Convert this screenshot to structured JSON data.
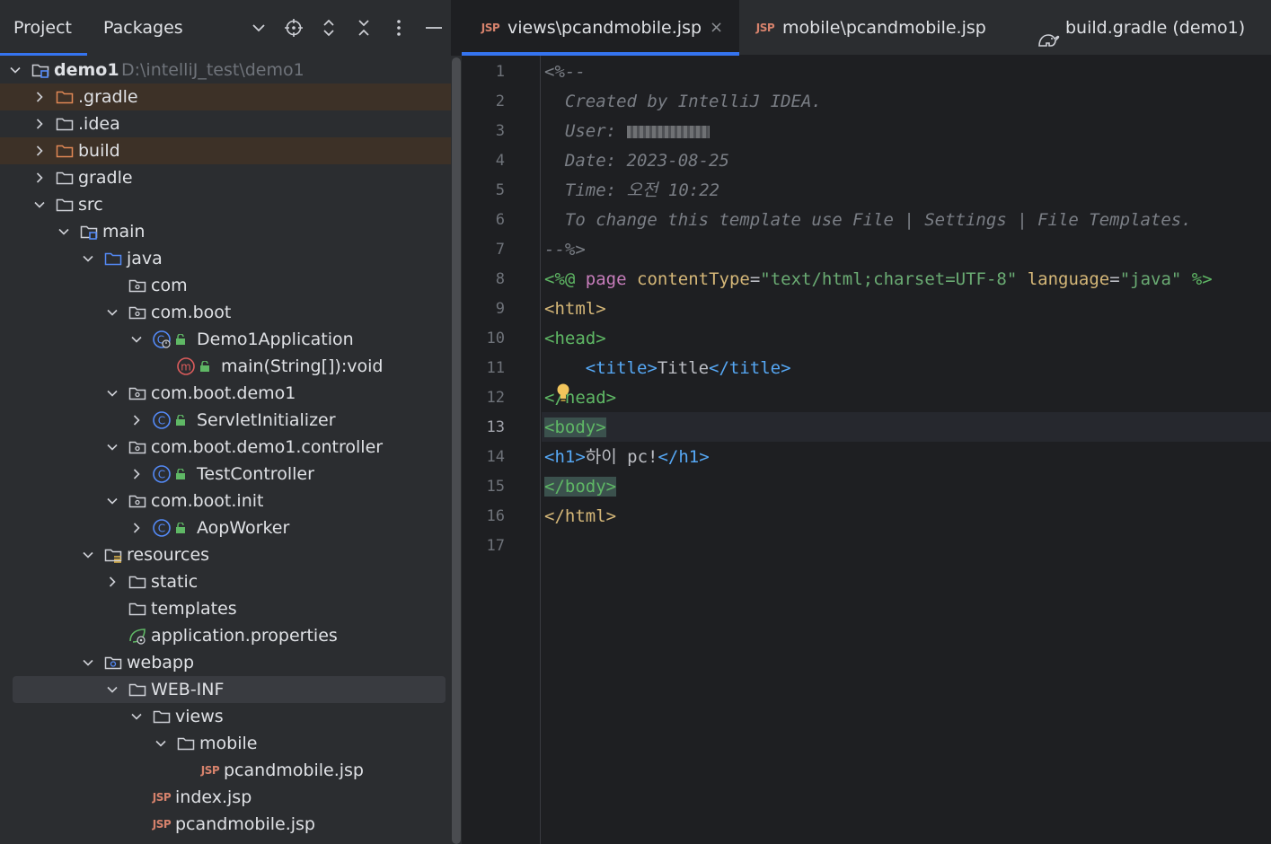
{
  "project_panel": {
    "tabs": [
      "Project",
      "Packages"
    ],
    "header_icons": [
      "chevron-down-icon",
      "locate-icon",
      "expand-all-icon",
      "collapse-all-icon",
      "more-icon",
      "minimize-icon"
    ],
    "tree": [
      {
        "label": "demo1",
        "extra": "D:\\intelliJ_test\\demo1",
        "level": 0,
        "expanded": true,
        "icon": "module-folder-icon",
        "bold": true
      },
      {
        "label": ".gradle",
        "level": 1,
        "expanded": false,
        "icon": "excluded-folder-icon",
        "highlight": true
      },
      {
        "label": ".idea",
        "level": 1,
        "expanded": false,
        "icon": "folder-icon"
      },
      {
        "label": "build",
        "level": 1,
        "expanded": false,
        "icon": "excluded-folder-icon",
        "highlight": true
      },
      {
        "label": "gradle",
        "level": 1,
        "expanded": false,
        "icon": "folder-icon"
      },
      {
        "label": "src",
        "level": 1,
        "expanded": true,
        "icon": "folder-icon"
      },
      {
        "label": "main",
        "level": 2,
        "expanded": true,
        "icon": "module-folder-icon"
      },
      {
        "label": "java",
        "level": 3,
        "expanded": true,
        "icon": "source-folder-icon"
      },
      {
        "label": "com",
        "level": 4,
        "icon": "package-icon"
      },
      {
        "label": "com.boot",
        "level": 4,
        "expanded": true,
        "icon": "package-icon"
      },
      {
        "label": "Demo1Application",
        "level": 5,
        "expanded": true,
        "icon": "spring-class-icon",
        "lock": true
      },
      {
        "label": "main(String[]):void",
        "level": 6,
        "icon": "method-icon",
        "lock": true
      },
      {
        "label": "com.boot.demo1",
        "level": 4,
        "expanded": true,
        "icon": "package-icon"
      },
      {
        "label": "ServletInitializer",
        "level": 5,
        "expanded": false,
        "icon": "class-icon",
        "lock": true
      },
      {
        "label": "com.boot.demo1.controller",
        "level": 4,
        "expanded": true,
        "icon": "package-icon"
      },
      {
        "label": "TestController",
        "level": 5,
        "expanded": false,
        "icon": "class-icon",
        "lock": true
      },
      {
        "label": "com.boot.init",
        "level": 4,
        "expanded": true,
        "icon": "package-icon"
      },
      {
        "label": "AopWorker",
        "level": 5,
        "expanded": false,
        "icon": "class-icon",
        "lock": true
      },
      {
        "label": "resources",
        "level": 3,
        "expanded": true,
        "icon": "resources-folder-icon"
      },
      {
        "label": "static",
        "level": 4,
        "expanded": false,
        "icon": "folder-icon"
      },
      {
        "label": "templates",
        "level": 4,
        "icon": "folder-icon"
      },
      {
        "label": "application.properties",
        "level": 4,
        "icon": "spring-properties-icon"
      },
      {
        "label": "webapp",
        "level": 3,
        "expanded": true,
        "icon": "web-folder-icon"
      },
      {
        "label": "WEB-INF",
        "level": 4,
        "expanded": true,
        "icon": "folder-icon",
        "selected": true
      },
      {
        "label": "views",
        "level": 5,
        "expanded": true,
        "icon": "folder-icon"
      },
      {
        "label": "mobile",
        "level": 6,
        "expanded": true,
        "icon": "folder-icon"
      },
      {
        "label": "pcandmobile.jsp",
        "level": 7,
        "icon": "jsp-file-icon"
      },
      {
        "label": "index.jsp",
        "level": 5,
        "icon": "jsp-file-icon"
      },
      {
        "label": "pcandmobile.jsp",
        "level": 5,
        "icon": "jsp-file-icon"
      }
    ]
  },
  "editor": {
    "tabs": [
      {
        "label": "views\\pcandmobile.jsp",
        "icon": "JSP",
        "active": true,
        "closable": true
      },
      {
        "label": "mobile\\pcandmobile.jsp",
        "icon": "JSP",
        "active": false
      },
      {
        "label": "build.gradle (demo1)",
        "icon": "gradle-icon",
        "active": false
      }
    ],
    "jsp_icon_text": "JSP",
    "close_glyph": "×",
    "current_line": 13,
    "line_numbers": [
      "1",
      "2",
      "3",
      "4",
      "5",
      "6",
      "7",
      "8",
      "9",
      "10",
      "11",
      "12",
      "13",
      "14",
      "15",
      "16",
      "17"
    ],
    "lines": {
      "l1": "<%--",
      "l2": "  Created by IntelliJ IDEA.",
      "l3": "  User: ",
      "l4": "  Date: 2023-08-25",
      "l5": "  Time: 오전 10:22",
      "l6": "  To change this template use File | Settings | File Templates.",
      "l7": "--%>",
      "l8": {
        "open": "<%@",
        "page": "page",
        "attr1": "contentType",
        "eq": "=",
        "val1": "\"text/html;charset=UTF-8\"",
        "attr2": "language",
        "val2": "\"java\"",
        "close": "%>"
      },
      "l9": "<html>",
      "l10": "<head>",
      "l11": {
        "indent": "    ",
        "open": "<title>",
        "text": "Title",
        "close": "</title>"
      },
      "l12": "</head>",
      "l13": "<body>",
      "l14": {
        "open": "<h1>",
        "text": "하이 pc!",
        "close": "</h1>"
      },
      "l15": "</body>",
      "l16": "</html>"
    }
  }
}
